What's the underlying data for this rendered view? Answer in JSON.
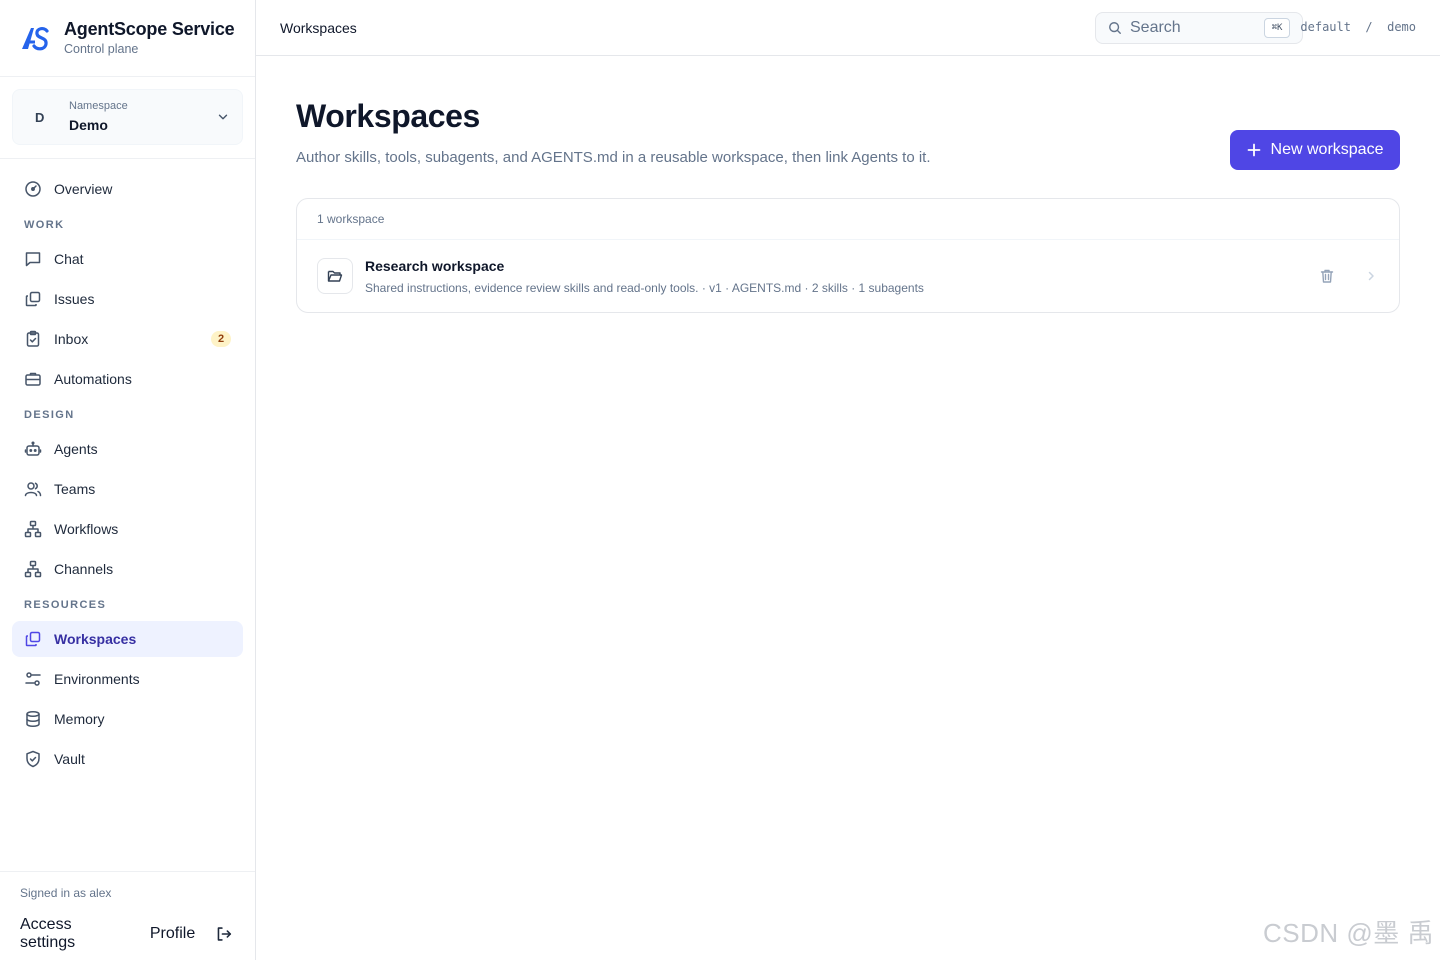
{
  "brand": {
    "name": "AgentScope Service",
    "subtitle": "Control plane"
  },
  "namespace": {
    "avatar": "D",
    "label": "Namespace",
    "value": "Demo"
  },
  "nav": {
    "overview": "Overview",
    "sections": {
      "work": "WORK",
      "design": "DESIGN",
      "resources": "RESOURCES"
    },
    "work": [
      {
        "label": "Chat"
      },
      {
        "label": "Issues"
      },
      {
        "label": "Inbox",
        "badge": "2"
      },
      {
        "label": "Automations"
      }
    ],
    "design": [
      {
        "label": "Agents"
      },
      {
        "label": "Teams"
      },
      {
        "label": "Workflows"
      },
      {
        "label": "Channels"
      }
    ],
    "resources": [
      {
        "label": "Workspaces",
        "active": true
      },
      {
        "label": "Environments"
      },
      {
        "label": "Memory"
      },
      {
        "label": "Vault"
      }
    ]
  },
  "footer": {
    "signed_in": "Signed in as alex",
    "access_settings": "Access settings",
    "profile": "Profile"
  },
  "topbar": {
    "breadcrumb": "Workspaces",
    "search_placeholder": "Search",
    "shortcut": "⌘K",
    "tenant": "default  /  demo"
  },
  "page": {
    "title": "Workspaces",
    "description": "Author skills, tools, subagents, and AGENTS.md in a reusable workspace, then link Agents to it.",
    "new_button": "New workspace"
  },
  "list": {
    "count_label": "1 workspace",
    "items": [
      {
        "title": "Research workspace",
        "meta": "Shared instructions, evidence review skills and read-only tools. · v1 · AGENTS.md · 2 skills · 1 subagents"
      }
    ]
  },
  "watermark": "CSDN @墨 禹",
  "colors": {
    "accent": "#4f46e5",
    "active_bg": "#eef2ff",
    "badge_bg": "#fef3c7"
  }
}
